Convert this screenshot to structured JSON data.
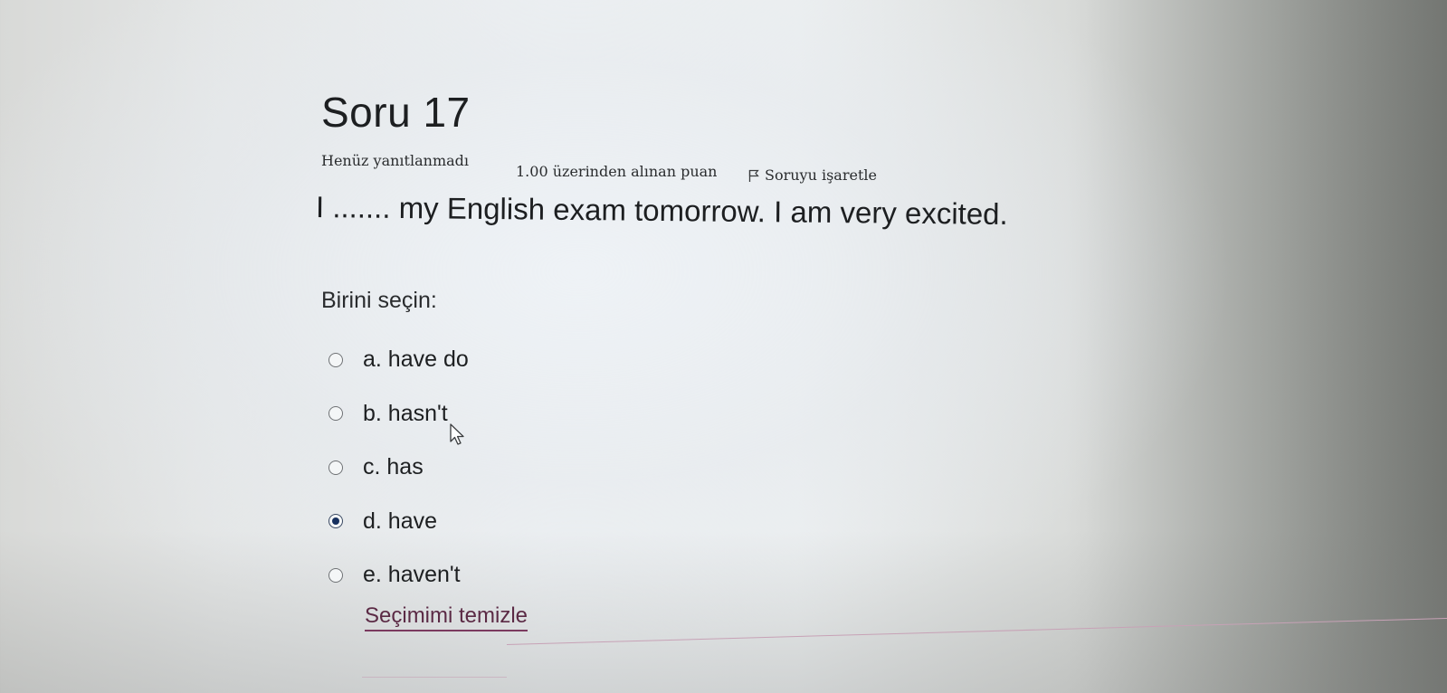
{
  "question": {
    "title": "Soru 17",
    "status": "Henüz yanıtlanmadı",
    "points": "1.00 üzerinden alınan puan",
    "flag_label": "Soruyu işaretle",
    "flag_icon": "flag-icon",
    "text": "I ....... my English exam tomorrow. I am very excited.",
    "prompt": "Birini seçin:",
    "options": [
      {
        "label": "a. have do",
        "selected": false
      },
      {
        "label": "b. hasn't",
        "selected": false
      },
      {
        "label": "c. has",
        "selected": false
      },
      {
        "label": "d. have",
        "selected": true
      },
      {
        "label": "e. haven't",
        "selected": false
      }
    ],
    "clear_label": "Seçimimi temizle"
  },
  "colors": {
    "link": "#5b2a45",
    "divider": "#c7a2b6",
    "radio_selected": "#17305f"
  }
}
